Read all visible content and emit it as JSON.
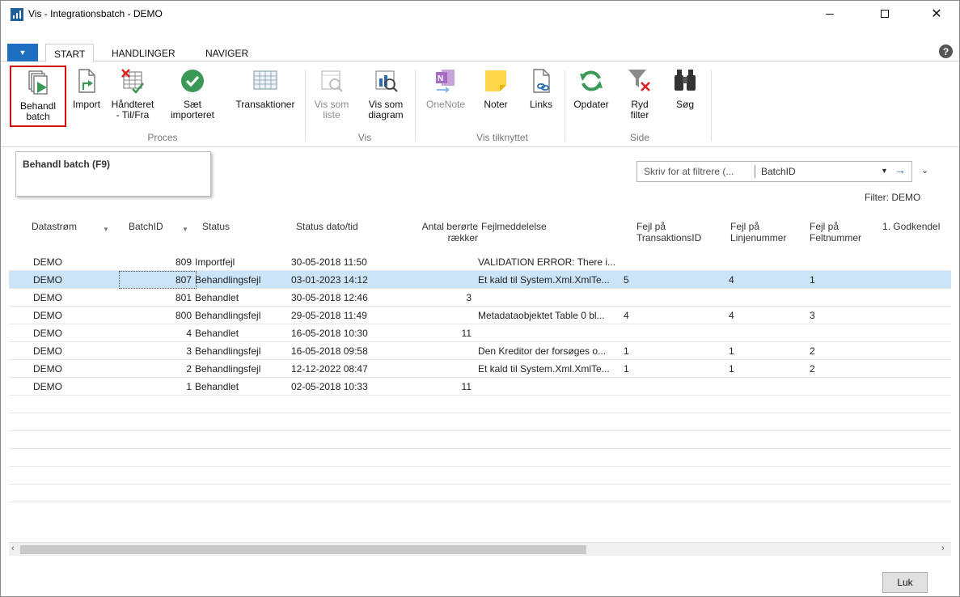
{
  "window": {
    "title": "Vis - Integrationsbatch - DEMO"
  },
  "tabs": [
    {
      "label": "START"
    },
    {
      "label": "HANDLINGER"
    },
    {
      "label": "NAVIGER"
    }
  ],
  "ribbon": {
    "buttons": {
      "behandl_batch": {
        "line1": "Behandl",
        "line2": "batch"
      },
      "import": {
        "line1": "Import",
        "line2": ""
      },
      "haandteret": {
        "line1": "Håndteret",
        "line2": "- Til/Fra"
      },
      "saet_importeret": {
        "line1": "Sæt",
        "line2": "importeret"
      },
      "transaktioner": {
        "line1": "Transaktioner",
        "line2": ""
      },
      "vis_som_liste": {
        "line1": "Vis som",
        "line2": "liste"
      },
      "vis_som_diagram": {
        "line1": "Vis som",
        "line2": "diagram"
      },
      "onenote": {
        "line1": "OneNote",
        "line2": ""
      },
      "noter": {
        "line1": "Noter",
        "line2": ""
      },
      "links": {
        "line1": "Links",
        "line2": ""
      },
      "opdater": {
        "line1": "Opdater",
        "line2": ""
      },
      "ryd_filter": {
        "line1": "Ryd",
        "line2": "filter"
      },
      "soeg": {
        "line1": "Søg",
        "line2": ""
      }
    },
    "groups": {
      "proces": "Proces",
      "vis": "Vis",
      "vis_tilknyttet": "Vis tilknyttet",
      "side": "Side"
    }
  },
  "tooltip": {
    "text": "Behandl batch (F9)"
  },
  "filter": {
    "placeholder": "Skriv for at filtrere (...",
    "field": "BatchID",
    "caption": "Filter: DEMO"
  },
  "grid": {
    "headers": {
      "datastroem": "Datastrøm",
      "batchid": "BatchID",
      "status": "Status",
      "status_dato": "Status dato/tid",
      "antal_line1": "Antal berørte",
      "antal_line2": "rækker",
      "fejlmeddelelse": "Fejlmeddelelse",
      "fejl_trans_line1": "Fejl på",
      "fejl_trans_line2": "TransaktionsID",
      "fejl_linje_line1": "Fejl på",
      "fejl_linje_line2": "Linjenummer",
      "fejl_felt_line1": "Fejl på",
      "fejl_felt_line2": "Feltnummer",
      "godkendel": "1. Godkendel"
    },
    "rows": [
      {
        "datastroem": "DEMO",
        "batchid": "809",
        "status": "Importfejl",
        "dato": "30-05-2018 11:50",
        "antal": "",
        "fejl": "VALIDATION ERROR: There i...",
        "trans": "",
        "linje": "",
        "felt": ""
      },
      {
        "datastroem": "DEMO",
        "batchid": "807",
        "status": "Behandlingsfejl",
        "dato": "03-01-2023 14:12",
        "antal": "",
        "fejl": "Et kald til System.Xml.XmlTe...",
        "trans": "5",
        "linje": "4",
        "felt": "1"
      },
      {
        "datastroem": "DEMO",
        "batchid": "801",
        "status": "Behandlet",
        "dato": "30-05-2018 12:46",
        "antal": "3",
        "fejl": "",
        "trans": "",
        "linje": "",
        "felt": ""
      },
      {
        "datastroem": "DEMO",
        "batchid": "800",
        "status": "Behandlingsfejl",
        "dato": "29-05-2018 11:49",
        "antal": "",
        "fejl": "Metadataobjektet Table 0 bl...",
        "trans": "4",
        "linje": "4",
        "felt": "3"
      },
      {
        "datastroem": "DEMO",
        "batchid": "4",
        "status": "Behandlet",
        "dato": "16-05-2018 10:30",
        "antal": "11",
        "fejl": "",
        "trans": "",
        "linje": "",
        "felt": ""
      },
      {
        "datastroem": "DEMO",
        "batchid": "3",
        "status": "Behandlingsfejl",
        "dato": "16-05-2018 09:58",
        "antal": "",
        "fejl": "Den Kreditor der forsøges o...",
        "trans": "1",
        "linje": "1",
        "felt": "2"
      },
      {
        "datastroem": "DEMO",
        "batchid": "2",
        "status": "Behandlingsfejl",
        "dato": "12-12-2022 08:47",
        "antal": "",
        "fejl": "Et kald til System.Xml.XmlTe...",
        "trans": "1",
        "linje": "1",
        "felt": "2"
      },
      {
        "datastroem": "DEMO",
        "batchid": "1",
        "status": "Behandlet",
        "dato": "02-05-2018 10:33",
        "antal": "11",
        "fejl": "",
        "trans": "",
        "linje": "",
        "felt": ""
      }
    ]
  },
  "footer": {
    "close_label": "Luk"
  },
  "colors": {
    "accent": "#1e6ec2",
    "selected_row": "#cce4f7",
    "highlight_border": "#d10f0f",
    "success_green": "#3a9a55"
  }
}
